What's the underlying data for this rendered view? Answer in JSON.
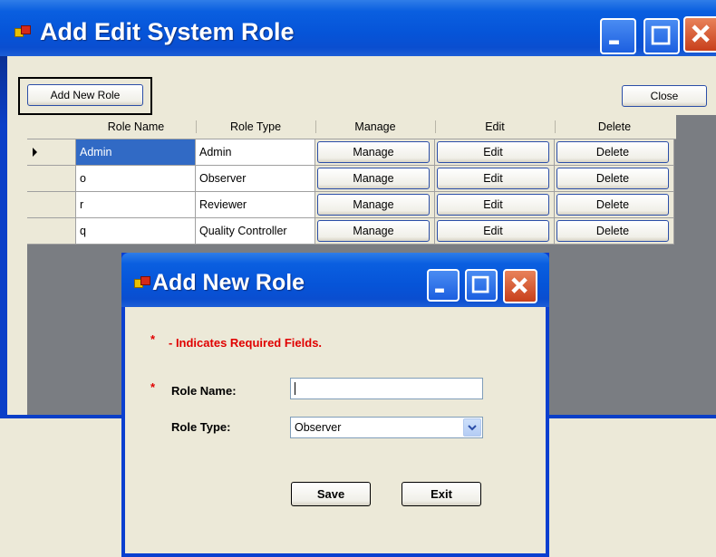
{
  "main": {
    "title": "Add Edit System Role",
    "add_button": "Add New Role",
    "close_button": "Close"
  },
  "grid": {
    "columns": [
      "Role Name",
      "Role Type",
      "Manage",
      "Edit",
      "Delete"
    ],
    "rows": [
      {
        "name": "Admin",
        "type": "Admin",
        "manage": "Manage",
        "edit": "Edit",
        "delete": "Delete",
        "selected": true
      },
      {
        "name": "o",
        "type": "Observer",
        "manage": "Manage",
        "edit": "Edit",
        "delete": "Delete"
      },
      {
        "name": "r",
        "type": "Reviewer",
        "manage": "Manage",
        "edit": "Edit",
        "delete": "Delete"
      },
      {
        "name": "q",
        "type": "Quality Controller",
        "manage": "Manage",
        "edit": "Edit",
        "delete": "Delete"
      }
    ]
  },
  "dialog": {
    "title": "Add New Role",
    "required_marker": "*",
    "required_note": "- Indicates Required Fields.",
    "role_name_label": "Role Name:",
    "role_name_value": "",
    "role_type_label": "Role Type:",
    "role_type_value": "Observer",
    "save_button": "Save",
    "exit_button": "Exit"
  },
  "colors": {
    "titlebar": "#0654d8",
    "selection": "#316ac5",
    "required": "#e00000"
  },
  "icons": [
    "app-icon",
    "minimize-icon",
    "maximize-icon",
    "close-icon",
    "row-pointer-icon",
    "dropdown-arrow-icon"
  ]
}
